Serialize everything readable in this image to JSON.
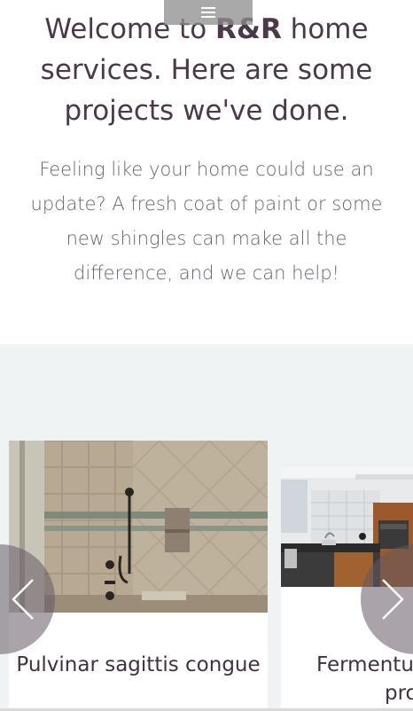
{
  "header": {
    "menu_icon": "hamburger-menu-icon"
  },
  "intro": {
    "heading_prefix": "Welcome to ",
    "heading_brand": "R&R",
    "heading_suffix": " home services. Here are some projects we've done.",
    "text": "Feeling like your home could use an update? A fresh coat of paint or some new shingles can make all the difference, and we can help!"
  },
  "gallery": {
    "prev_icon": "chevron-left-icon",
    "next_icon": "chevron-right-icon",
    "projects": [
      {
        "caption": "Pulvinar sagittis congue",
        "image": "tiled-shower-photo"
      },
      {
        "caption_line1": "Fermentur",
        "caption_line2": "pro",
        "image": "kitchen-photo"
      }
    ]
  },
  "colors": {
    "heading": "#4a3a49",
    "body_text": "#6e6170",
    "gallery_bg": "#f0f3f4"
  }
}
